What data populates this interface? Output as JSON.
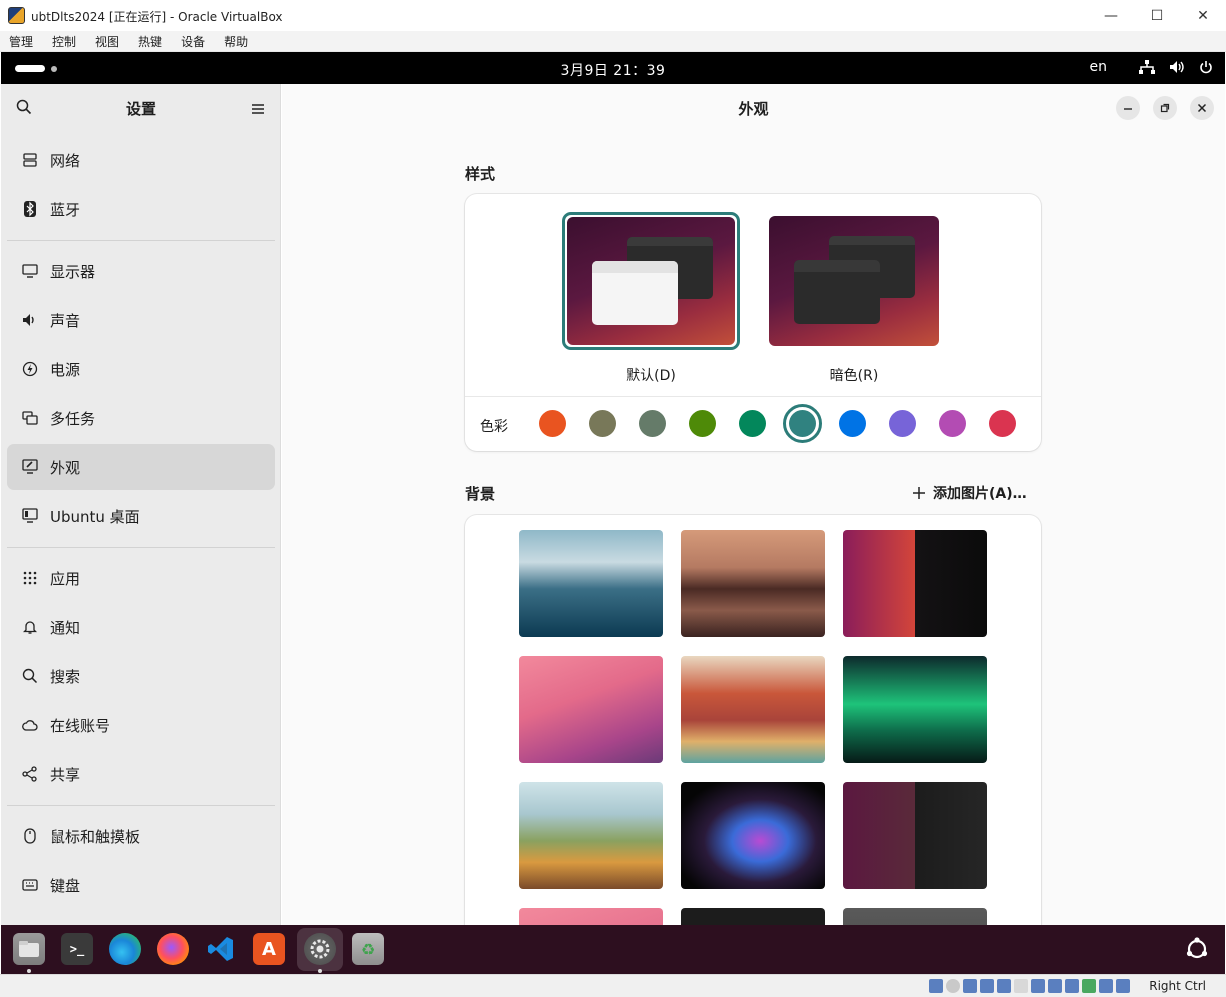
{
  "host": {
    "title": "ubtDlts2024 [正在运行] - Oracle VirtualBox",
    "controls": {
      "minimize": "—",
      "maximize": "☐",
      "close": "✕"
    },
    "menu": [
      "管理",
      "控制",
      "视图",
      "热键",
      "设备",
      "帮助"
    ],
    "status_key": "Right Ctrl"
  },
  "topbar": {
    "clock": "3月9日  21：39",
    "language": "en"
  },
  "sidebar": {
    "title": "设置",
    "items": [
      {
        "label": "网络",
        "icon": "network-icon"
      },
      {
        "label": "蓝牙",
        "icon": "bluetooth-icon"
      },
      {
        "label": "显示器",
        "icon": "display-icon"
      },
      {
        "label": "声音",
        "icon": "sound-icon"
      },
      {
        "label": "电源",
        "icon": "power-icon"
      },
      {
        "label": "多任务",
        "icon": "multitasking-icon"
      },
      {
        "label": "外观",
        "icon": "appearance-icon",
        "active": true
      },
      {
        "label": "Ubuntu 桌面",
        "icon": "ubuntu-desktop-icon"
      },
      {
        "label": "应用",
        "icon": "apps-icon"
      },
      {
        "label": "通知",
        "icon": "bell-icon"
      },
      {
        "label": "搜索",
        "icon": "search-icon"
      },
      {
        "label": "在线账号",
        "icon": "cloud-icon"
      },
      {
        "label": "共享",
        "icon": "share-icon"
      },
      {
        "label": "鼠标和触摸板",
        "icon": "mouse-icon"
      },
      {
        "label": "键盘",
        "icon": "keyboard-icon"
      }
    ]
  },
  "main": {
    "title": "外观",
    "style_section": "样式",
    "styles": [
      {
        "label": "默认(D)",
        "selected": true
      },
      {
        "label": "暗色(R)",
        "selected": false
      }
    ],
    "color_label": "色彩",
    "accent_colors": [
      "#e95420",
      "#787859",
      "#657b69",
      "#4e8a08",
      "#03875b",
      "#308280",
      "#0073e5",
      "#7764d8",
      "#b34cb3",
      "#da3450"
    ],
    "accent_selected": 5,
    "background_section": "背景",
    "add_picture": "添加图片(A)…"
  },
  "dock": {
    "apps": [
      "files-icon",
      "terminal-icon",
      "edge-icon",
      "firefox-icon",
      "vscode-icon",
      "app-center-icon",
      "settings-icon",
      "trash-icon"
    ],
    "terminal_glyph": ">_",
    "appcenter_glyph": "A",
    "trash_glyph": "♻"
  }
}
